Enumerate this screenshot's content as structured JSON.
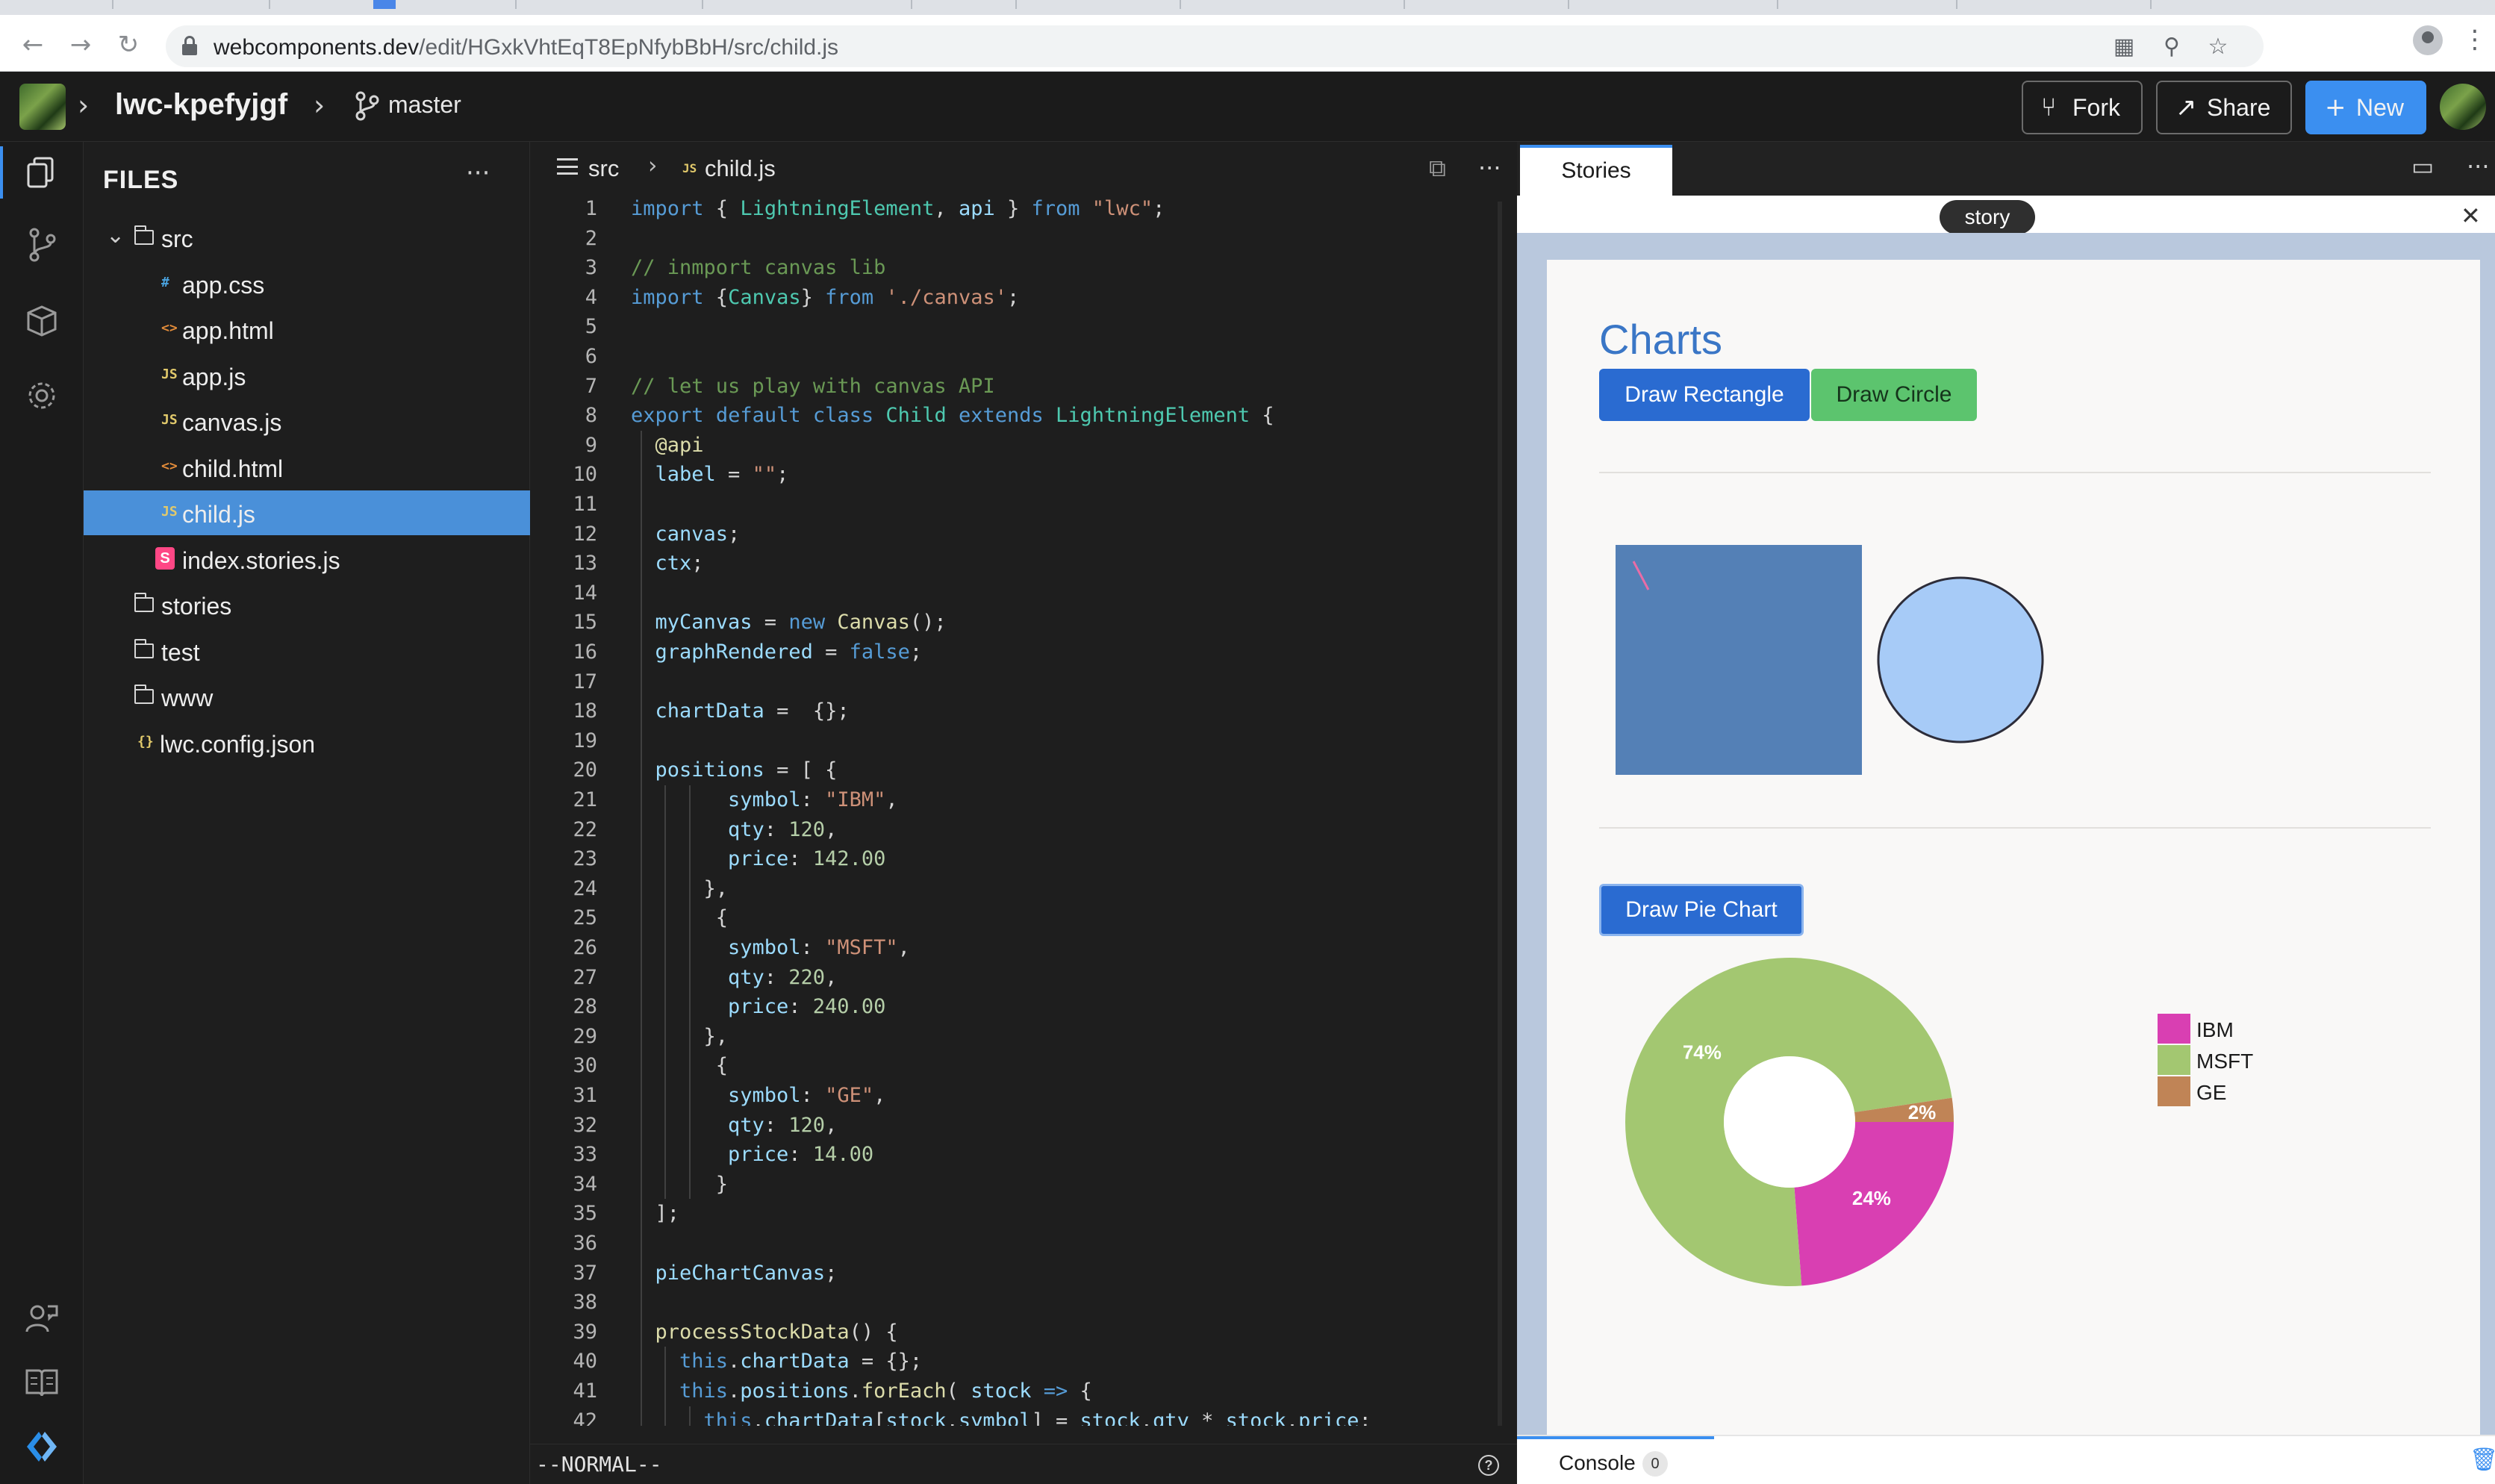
{
  "browser": {
    "url_host": "webcomponents.dev",
    "url_path": "/edit/HGxkVhtEqT8EpNfybBbH/src/child.js"
  },
  "header": {
    "project_name": "lwc-kpefyjgf",
    "branch": "master",
    "fork_label": "Fork",
    "share_label": "Share",
    "new_label": "New"
  },
  "sidebar": {
    "title": "FILES",
    "more": "···",
    "items": [
      {
        "name": "src",
        "kind": "folder",
        "depth": 0,
        "expanded": true
      },
      {
        "name": "app.css",
        "kind": "css",
        "depth": 1
      },
      {
        "name": "app.html",
        "kind": "html",
        "depth": 1
      },
      {
        "name": "app.js",
        "kind": "js",
        "depth": 1
      },
      {
        "name": "canvas.js",
        "kind": "js",
        "depth": 1
      },
      {
        "name": "child.html",
        "kind": "html",
        "depth": 1
      },
      {
        "name": "child.js",
        "kind": "js",
        "depth": 1,
        "selected": true
      },
      {
        "name": "index.stories.js",
        "kind": "story",
        "depth": 1
      },
      {
        "name": "stories",
        "kind": "folder",
        "depth": 0
      },
      {
        "name": "test",
        "kind": "folder",
        "depth": 0
      },
      {
        "name": "www",
        "kind": "folder-plain",
        "depth": 0
      },
      {
        "name": "lwc.config.json",
        "kind": "json",
        "depth": 0
      }
    ]
  },
  "editor": {
    "breadcrumb_folder": "src",
    "breadcrumb_file": "child.js",
    "mode": "--NORMAL--",
    "lines": [
      {
        "n": 1,
        "indent": 0,
        "tokens": [
          [
            "kw",
            "import"
          ],
          [
            "p",
            " { "
          ],
          [
            "cls",
            "LightningElement"
          ],
          [
            "p",
            ", "
          ],
          [
            "prop",
            "api"
          ],
          [
            "p",
            " } "
          ],
          [
            "kw",
            "from"
          ],
          [
            "p",
            " "
          ],
          [
            "str",
            "\"lwc\""
          ],
          [
            "p",
            ";"
          ]
        ]
      },
      {
        "n": 2,
        "indent": 0,
        "tokens": []
      },
      {
        "n": 3,
        "indent": 0,
        "tokens": [
          [
            "com",
            "// inmport canvas lib"
          ]
        ]
      },
      {
        "n": 4,
        "indent": 0,
        "tokens": [
          [
            "kw",
            "import"
          ],
          [
            "p",
            " {"
          ],
          [
            "cls",
            "Canvas"
          ],
          [
            "p",
            "} "
          ],
          [
            "kw",
            "from"
          ],
          [
            "p",
            " "
          ],
          [
            "str",
            "'./canvas'"
          ],
          [
            "p",
            ";"
          ]
        ]
      },
      {
        "n": 5,
        "indent": 0,
        "tokens": []
      },
      {
        "n": 6,
        "indent": 0,
        "tokens": []
      },
      {
        "n": 7,
        "indent": 0,
        "tokens": [
          [
            "com",
            "// let us play with canvas API"
          ]
        ]
      },
      {
        "n": 8,
        "indent": 0,
        "tokens": [
          [
            "kw",
            "export"
          ],
          [
            "p",
            " "
          ],
          [
            "kw",
            "default"
          ],
          [
            "p",
            " "
          ],
          [
            "kw",
            "class"
          ],
          [
            "p",
            " "
          ],
          [
            "cls",
            "Child"
          ],
          [
            "p",
            " "
          ],
          [
            "kw",
            "extends"
          ],
          [
            "p",
            " "
          ],
          [
            "cls",
            "LightningElement"
          ],
          [
            "p",
            " {"
          ]
        ]
      },
      {
        "n": 9,
        "indent": 1,
        "tokens": [
          [
            "dec",
            "@api"
          ]
        ]
      },
      {
        "n": 10,
        "indent": 1,
        "tokens": [
          [
            "prop",
            "label"
          ],
          [
            "p",
            " = "
          ],
          [
            "str",
            "\"\""
          ],
          [
            "p",
            ";"
          ]
        ]
      },
      {
        "n": 11,
        "indent": 1,
        "tokens": []
      },
      {
        "n": 12,
        "indent": 1,
        "tokens": [
          [
            "prop",
            "canvas"
          ],
          [
            "p",
            ";"
          ]
        ]
      },
      {
        "n": 13,
        "indent": 1,
        "tokens": [
          [
            "prop",
            "ctx"
          ],
          [
            "p",
            ";"
          ]
        ]
      },
      {
        "n": 14,
        "indent": 1,
        "tokens": []
      },
      {
        "n": 15,
        "indent": 1,
        "tokens": [
          [
            "prop",
            "myCanvas"
          ],
          [
            "p",
            " = "
          ],
          [
            "kw",
            "new"
          ],
          [
            "p",
            " "
          ],
          [
            "fn",
            "Canvas"
          ],
          [
            "p",
            "();"
          ]
        ]
      },
      {
        "n": 16,
        "indent": 1,
        "tokens": [
          [
            "prop",
            "graphRendered"
          ],
          [
            "p",
            " = "
          ],
          [
            "kw",
            "false"
          ],
          [
            "p",
            ";"
          ]
        ]
      },
      {
        "n": 17,
        "indent": 1,
        "tokens": []
      },
      {
        "n": 18,
        "indent": 1,
        "tokens": [
          [
            "prop",
            "chartData"
          ],
          [
            "p",
            " =  {};"
          ]
        ]
      },
      {
        "n": 19,
        "indent": 1,
        "tokens": []
      },
      {
        "n": 20,
        "indent": 1,
        "tokens": [
          [
            "prop",
            "positions"
          ],
          [
            "p",
            " = [ {"
          ]
        ]
      },
      {
        "n": 21,
        "indent": 4,
        "tokens": [
          [
            "prop",
            "symbol"
          ],
          [
            "p",
            ": "
          ],
          [
            "str",
            "\"IBM\""
          ],
          [
            "p",
            ","
          ]
        ]
      },
      {
        "n": 22,
        "indent": 4,
        "tokens": [
          [
            "prop",
            "qty"
          ],
          [
            "p",
            ": "
          ],
          [
            "num",
            "120"
          ],
          [
            "p",
            ","
          ]
        ]
      },
      {
        "n": 23,
        "indent": 4,
        "tokens": [
          [
            "prop",
            "price"
          ],
          [
            "p",
            ": "
          ],
          [
            "num",
            "142.00"
          ]
        ]
      },
      {
        "n": 24,
        "indent": 3,
        "tokens": [
          [
            "p",
            "},"
          ]
        ]
      },
      {
        "n": 25,
        "indent": 3,
        "tokens": [
          [
            "p",
            " {"
          ]
        ]
      },
      {
        "n": 26,
        "indent": 4,
        "tokens": [
          [
            "prop",
            "symbol"
          ],
          [
            "p",
            ": "
          ],
          [
            "str",
            "\"MSFT\""
          ],
          [
            "p",
            ","
          ]
        ]
      },
      {
        "n": 27,
        "indent": 4,
        "tokens": [
          [
            "prop",
            "qty"
          ],
          [
            "p",
            ": "
          ],
          [
            "num",
            "220"
          ],
          [
            "p",
            ","
          ]
        ]
      },
      {
        "n": 28,
        "indent": 4,
        "tokens": [
          [
            "prop",
            "price"
          ],
          [
            "p",
            ": "
          ],
          [
            "num",
            "240.00"
          ]
        ]
      },
      {
        "n": 29,
        "indent": 3,
        "tokens": [
          [
            "p",
            "},"
          ]
        ]
      },
      {
        "n": 30,
        "indent": 3,
        "tokens": [
          [
            "p",
            " {"
          ]
        ]
      },
      {
        "n": 31,
        "indent": 4,
        "tokens": [
          [
            "prop",
            "symbol"
          ],
          [
            "p",
            ": "
          ],
          [
            "str",
            "\"GE\""
          ],
          [
            "p",
            ","
          ]
        ]
      },
      {
        "n": 32,
        "indent": 4,
        "tokens": [
          [
            "prop",
            "qty"
          ],
          [
            "p",
            ": "
          ],
          [
            "num",
            "120"
          ],
          [
            "p",
            ","
          ]
        ]
      },
      {
        "n": 33,
        "indent": 4,
        "tokens": [
          [
            "prop",
            "price"
          ],
          [
            "p",
            ": "
          ],
          [
            "num",
            "14.00"
          ]
        ]
      },
      {
        "n": 34,
        "indent": 3,
        "tokens": [
          [
            "p",
            " }"
          ]
        ]
      },
      {
        "n": 35,
        "indent": 1,
        "tokens": [
          [
            "p",
            "];"
          ]
        ]
      },
      {
        "n": 36,
        "indent": 1,
        "tokens": []
      },
      {
        "n": 37,
        "indent": 1,
        "tokens": [
          [
            "prop",
            "pieChartCanvas"
          ],
          [
            "p",
            ";"
          ]
        ]
      },
      {
        "n": 38,
        "indent": 1,
        "tokens": []
      },
      {
        "n": 39,
        "indent": 1,
        "tokens": [
          [
            "fn",
            "processStockData"
          ],
          [
            "p",
            "() {"
          ]
        ]
      },
      {
        "n": 40,
        "indent": 2,
        "tokens": [
          [
            "kw",
            "this"
          ],
          [
            "p",
            "."
          ],
          [
            "prop",
            "chartData"
          ],
          [
            "p",
            " = {};"
          ]
        ]
      },
      {
        "n": 41,
        "indent": 2,
        "tokens": [
          [
            "kw",
            "this"
          ],
          [
            "p",
            "."
          ],
          [
            "prop",
            "positions"
          ],
          [
            "p",
            "."
          ],
          [
            "fn",
            "forEach"
          ],
          [
            "p",
            "( "
          ],
          [
            "prop",
            "stock"
          ],
          [
            "p",
            " "
          ],
          [
            "kw",
            "=>"
          ],
          [
            "p",
            " {"
          ]
        ]
      },
      {
        "n": 42,
        "indent": 3,
        "tokens": [
          [
            "kw",
            "this"
          ],
          [
            "p",
            "."
          ],
          [
            "prop",
            "chartData"
          ],
          [
            "p",
            "["
          ],
          [
            "prop",
            "stock"
          ],
          [
            "p",
            "."
          ],
          [
            "prop",
            "symbol"
          ],
          [
            "p",
            "] = "
          ],
          [
            "prop",
            "stock"
          ],
          [
            "p",
            "."
          ],
          [
            "prop",
            "qty"
          ],
          [
            "p",
            " * "
          ],
          [
            "prop",
            "stock"
          ],
          [
            "p",
            "."
          ],
          [
            "prop",
            "price"
          ],
          [
            "p",
            ";"
          ]
        ]
      }
    ]
  },
  "preview": {
    "tab_label": "Stories",
    "story_pill": "story",
    "heading": "Charts",
    "btn_rect": "Draw Rectangle",
    "btn_circle": "Draw Circle",
    "btn_pie": "Draw Pie Chart",
    "console_label": "Console",
    "console_count": "0",
    "rect_color": "#5480b6",
    "circle_fill": "#a7cbf7",
    "circle_stroke": "#2d2d3a"
  },
  "chart_data": {
    "type": "pie",
    "donut": true,
    "categories": [
      "IBM",
      "MSFT",
      "GE"
    ],
    "values": [
      17040,
      52800,
      1680
    ],
    "slice_labels": [
      "24%",
      "74%",
      "2%"
    ],
    "colors": [
      "#d93fb2",
      "#a3c771",
      "#c08456"
    ],
    "legend_position": "right"
  }
}
